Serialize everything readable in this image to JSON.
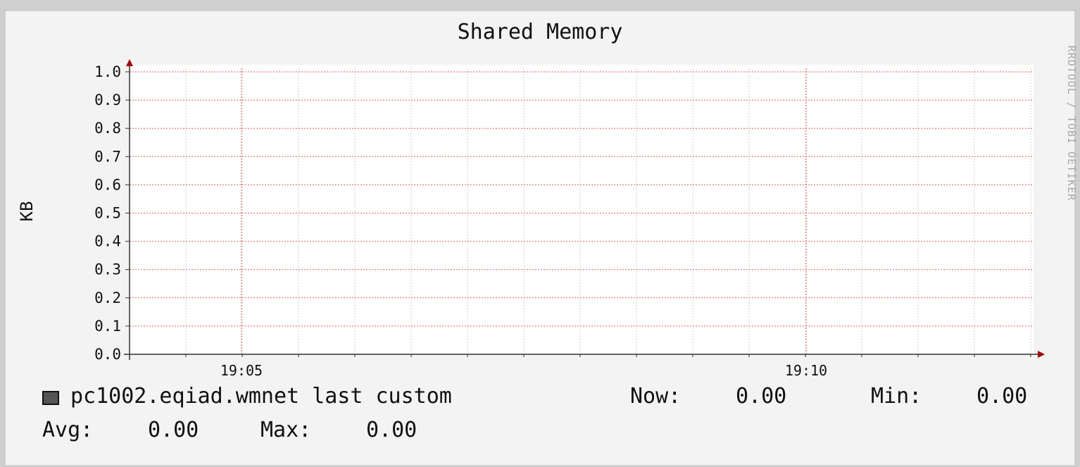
{
  "watermark": "RRDTOOL / TOBI OETIKER",
  "colors": {
    "background": "#f3f3f3",
    "canvas": "#ffffff",
    "grid_major": "#e06060",
    "grid_minor": "#cfcfcf",
    "axis": "#a00000",
    "series": "#555555"
  },
  "chart_data": {
    "type": "line",
    "title": "Shared Memory",
    "ylabel": "KB",
    "xlabel": "",
    "ylim": [
      0.0,
      1.0
    ],
    "y_ticks": [
      "0.0",
      "0.1",
      "0.2",
      "0.3",
      "0.4",
      "0.5",
      "0.6",
      "0.7",
      "0.8",
      "0.9",
      "1.0"
    ],
    "x_labels": [
      "19:05",
      "19:10"
    ],
    "grid": true,
    "series": [
      {
        "name": "pc1002.eqiad.wmnet last custom",
        "values": []
      }
    ]
  },
  "legend": {
    "swatch_color": "#555555",
    "series_label": "pc1002.eqiad.wmnet last custom",
    "now_label": "Now:",
    "now_value": "0.00",
    "min_label": "Min:",
    "min_value": "0.00",
    "avg_label": "Avg:",
    "avg_value": "0.00",
    "max_label": "Max:",
    "max_value": "0.00"
  }
}
